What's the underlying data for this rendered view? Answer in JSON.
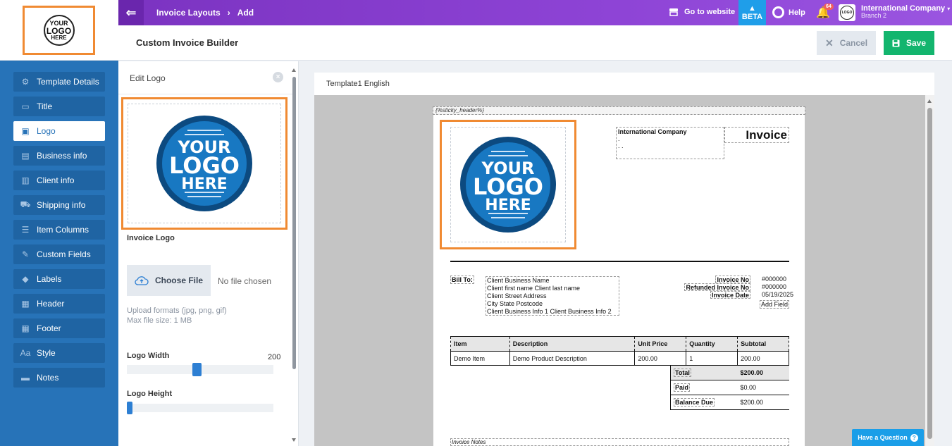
{
  "topbar": {
    "breadcrumb": [
      "Invoice Layouts",
      "Add"
    ],
    "goto_website": "Go to website",
    "beta": "BETA",
    "help": "Help",
    "notifications_count": "64",
    "company_name": "International Company",
    "branch": "Branch 2",
    "logo_text": [
      "YOUR",
      "LOGO",
      "HERE"
    ]
  },
  "sidebar": {
    "logo_text": [
      "YOUR",
      "LOGO",
      "HERE"
    ],
    "items": [
      {
        "label": "Template Details",
        "icon": "gear-icon"
      },
      {
        "label": "Title",
        "icon": "window-icon"
      },
      {
        "label": "Logo",
        "icon": "image-icon",
        "active": true
      },
      {
        "label": "Business info",
        "icon": "briefcase-icon"
      },
      {
        "label": "Client info",
        "icon": "id-card-icon"
      },
      {
        "label": "Shipping info",
        "icon": "truck-icon"
      },
      {
        "label": "Item Columns",
        "icon": "columns-icon"
      },
      {
        "label": "Custom Fields",
        "icon": "edit-icon"
      },
      {
        "label": "Labels",
        "icon": "tag-icon"
      },
      {
        "label": "Header",
        "icon": "header-icon"
      },
      {
        "label": "Footer",
        "icon": "footer-icon"
      },
      {
        "label": "Style",
        "icon": "font-icon"
      },
      {
        "label": "Notes",
        "icon": "chat-icon"
      }
    ]
  },
  "header": {
    "title": "Custom Invoice Builder",
    "cancel": "Cancel",
    "save": "Save"
  },
  "edit_panel": {
    "title": "Edit Logo",
    "logo_label": "Invoice Logo",
    "choose_file": "Choose File",
    "no_file": "No file chosen",
    "upload_formats": "Upload formats (jpg, png, gif)",
    "max_size": "Max file size: 1 MB",
    "logo_width_label": "Logo Width",
    "logo_width_value": "200",
    "logo_width_fraction": 0.44,
    "logo_height_label": "Logo Height",
    "logo_height_fraction": 0.0,
    "logo_text": [
      "YOUR",
      "LOGO",
      "HERE"
    ]
  },
  "canvas": {
    "template_title": "Template1 English",
    "sticky_header": "{%sticky_header%}",
    "company_name": "International Company",
    "company_line2": ".",
    "company_line3": ". .",
    "invoice_title": "Invoice",
    "bill_to": "Bill To:",
    "client_lines": [
      "Client Business Name",
      "Client first name Client last name",
      "Client Street Address",
      "City State Postcode",
      "Client Business Info 1 Client Business Info 2"
    ],
    "meta": [
      {
        "label": "Invoice No",
        "value": "#000000"
      },
      {
        "label": "Refunded Invoice No",
        "value": "#000000"
      },
      {
        "label": "Invoice Date",
        "value": "05/19/2025"
      }
    ],
    "add_field": "Add Field",
    "table_headers": [
      "Item",
      "Description",
      "Unit Price",
      "Quantity",
      "Subtotal"
    ],
    "table_rows": [
      [
        "Demo Item",
        "Demo Product Description",
        "200.00",
        "1",
        "200.00"
      ]
    ],
    "totals": [
      {
        "label": "Total",
        "value": "$200.00"
      },
      {
        "label": "Paid",
        "value": "$0.00"
      },
      {
        "label": "Balance Due",
        "value": "$200.00"
      }
    ],
    "notes_label": "Invoice Notes",
    "logo_text": [
      "YOUR",
      "LOGO",
      "HERE"
    ]
  },
  "have_question": "Have a Question",
  "colors": {
    "sidebar": "#2773b8",
    "topbar": "#8e44d6",
    "accent_orange": "#f08a32",
    "save_green": "#13b56e",
    "beta_blue": "#1f9ee9"
  }
}
